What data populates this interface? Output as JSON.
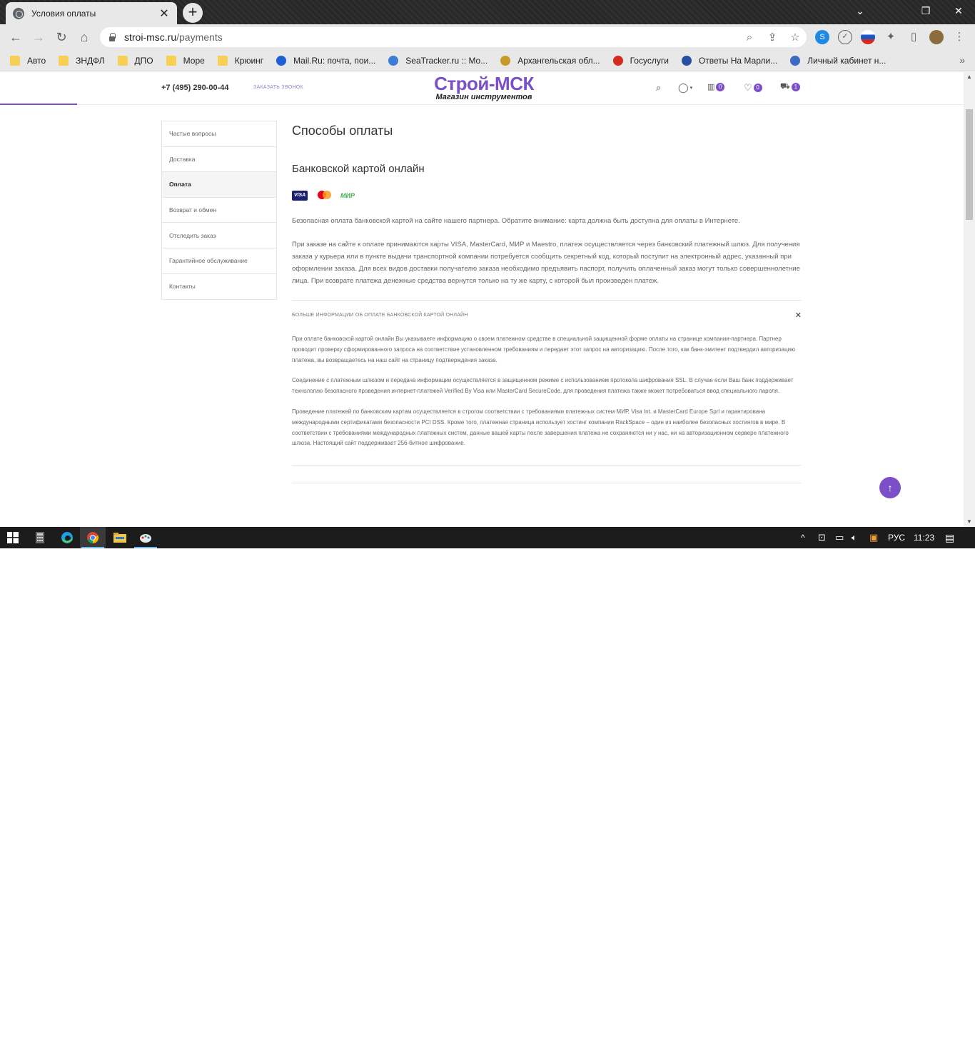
{
  "browser": {
    "tab_title": "Условия оплаты",
    "tab_close": "✕",
    "new_tab": "+",
    "url_host": "stroi-msc.ru",
    "url_path": "/payments",
    "bookmarks": [
      {
        "label": "Авто",
        "icon": "folder-icon",
        "color": "#f7cf55"
      },
      {
        "label": "ЗНДФЛ",
        "icon": "folder-icon",
        "color": "#f7cf55"
      },
      {
        "label": "ДПО",
        "icon": "folder-icon",
        "color": "#f7cf55"
      },
      {
        "label": "Море",
        "icon": "folder-icon",
        "color": "#f7cf55"
      },
      {
        "label": "Крюинг",
        "icon": "folder-icon",
        "color": "#f7cf55"
      },
      {
        "label": "Mail.Ru: почта, пои...",
        "icon": "mail-at-icon",
        "color": "#1f5fd6"
      },
      {
        "label": "SeaTracker.ru :: Mo...",
        "icon": "globe-icon",
        "color": "#3c7bd6"
      },
      {
        "label": "Архангельская обл...",
        "icon": "emblem-icon",
        "color": "#c89a2c"
      },
      {
        "label": "Госуслуги",
        "icon": "russia-flag-icon",
        "color": "#d52b1e"
      },
      {
        "label": "Ответы На Марли...",
        "icon": "checkmark-icon",
        "color": "#2a4fa0"
      },
      {
        "label": "Личный кабинет н...",
        "icon": "emblem-icon",
        "color": "#3a6cc4"
      }
    ],
    "bookmarks_more": "»"
  },
  "site": {
    "phone": "+7 (495) 290-00-44",
    "callback": "ЗАКАЗАТЬ ЗВОНОК",
    "brand": "Строй-МСК",
    "tagline": "Магазин инструментов",
    "accent": "#7b4fc8",
    "compare_count": "0",
    "favorites_count": "0",
    "cart_count": "1"
  },
  "sidebar": {
    "items": [
      {
        "label": "Частые вопросы"
      },
      {
        "label": "Доставка"
      },
      {
        "label": "Оплата"
      },
      {
        "label": "Возврат и обмен"
      },
      {
        "label": "Отследить заказ"
      },
      {
        "label": "Гарантийное обслуживание"
      },
      {
        "label": "Контакты"
      }
    ],
    "active_index": 2
  },
  "content": {
    "title": "Способы оплаты",
    "section_title": "Банковской картой онлайн",
    "cards": {
      "visa": "VISA",
      "mir": "МИР"
    },
    "para1": "Безопасная оплата банковской картой на сайте нашего партнера. Обратите внимание: карта должна быть доступна для оплаты в Интернете.",
    "para2": "При заказе на сайте к оплате принимаются карты VISA, MasterCard, МИР и Maestro, платеж осуществляется через банковский платежный шлюз. Для получения заказа у курьера или в пункте выдачи транспортной компании потребуется сообщить секретный код, который поступит на электронный адрес, указанный при оформлении заказа. Для всех видов доставки получателю заказа необходимо предъявить паспорт, получить оплаченный заказ могут только совершеннолетние лица. При возврате платежа денежные средства вернутся только на ту же карту, с которой был произведен платеж.",
    "accordion_title": "БОЛЬШЕ ИНФОРМАЦИИ ОБ ОПЛАТЕ БАНКОВСКОЙ КАРТОЙ ОНЛАЙН",
    "accordion_close": "✕",
    "acc_para1": "При оплате банковской картой онлайн Вы указываете информацию о своем платежном средстве в специальной защищенной форме оплаты на странице компании-партнера. Партнер проводит проверку сформированного запроса на соответствие установленном требованиям и передает этот запрос на авторизацию. После того, как банк-эмитент подтвердил авторизацию платежа, вы возвращаетесь на наш сайт на страницу подтверждения заказа.",
    "acc_para2": "Соединение с платежным шлюзом и передача информации осуществляется в защищенном режиме с использованием протокола шифрования SSL. В случае если Ваш банк поддерживает технологию безопасного проведения интернет-платежей Verified By Visa или MasterCard SecureCode, для проведения платежа также может потребоваться ввод специального пароля.",
    "acc_para3": "Проведение платежей по банковским картам осуществляется в строгом соответствии с требованиями платежных систем МИР, Visa Int. и MasterCard Europe Sprl и гарантирована международными сертификатами безопасности PCI DSS. Кроме того, платежная страница использует хостинг компании RackSpace – один из наиболее безопасных хостингов в мире. В соответствии с требованиями международных платежных систем, данные вашей карты после завершения платежа не сохраняются ни у нас, ни на авторизационном сервере платежного шлюза. Настоящий сайт поддерживает 256-битное шифрование."
  },
  "taskbar": {
    "language": "РУС",
    "time": "11:23"
  }
}
